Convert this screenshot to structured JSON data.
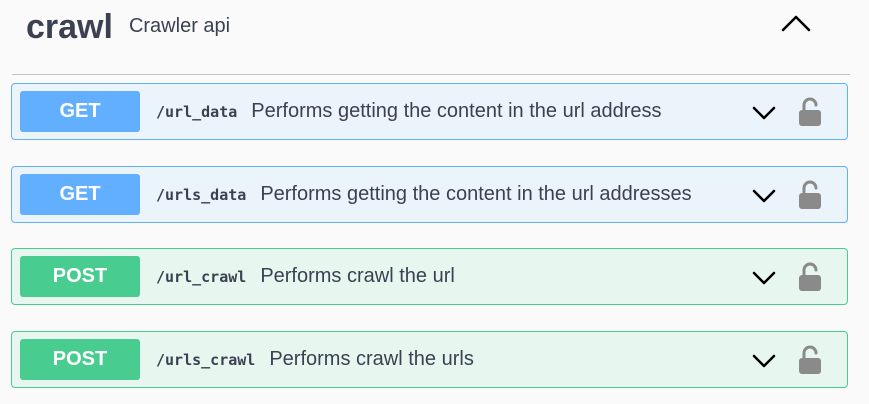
{
  "tag": {
    "name": "crawl",
    "description": "Crawler api",
    "toggle_icon": "chevron-up-icon"
  },
  "operations": [
    {
      "method": "GET",
      "path": "/url_data",
      "summary": "Performs getting the content in the url address"
    },
    {
      "method": "GET",
      "path": "/urls_data",
      "summary": "Performs getting the content in the url addresses"
    },
    {
      "method": "POST",
      "path": "/url_crawl",
      "summary": "Performs crawl the url"
    },
    {
      "method": "POST",
      "path": "/urls_crawl",
      "summary": "Performs crawl the urls"
    }
  ],
  "icons": {
    "expand": "chevron-down-icon",
    "authorize": "lock-icon"
  },
  "colors": {
    "get": "#61affe",
    "post": "#49cc90",
    "get_bg": "#ebf3fb",
    "post_bg": "#e8f6f0",
    "text": "#3b4151",
    "lock": "#8a8a8a"
  }
}
